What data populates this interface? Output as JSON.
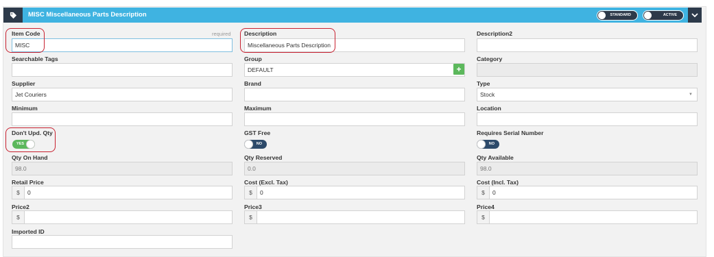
{
  "header": {
    "title": "MISC Miscellaneous Parts Description",
    "toggle_standard": "STANDARD",
    "toggle_active": "ACTIVE",
    "tag_icon": "tag-icon",
    "chevron_icon": "chevron-down-icon",
    "color_bar": "#3fb3e1",
    "color_dark": "#2d3a4a"
  },
  "fields": {
    "item_code": {
      "label": "Item Code",
      "required": "required",
      "value": "MISC"
    },
    "description": {
      "label": "Description",
      "value": "Miscellaneous Parts Description"
    },
    "description2": {
      "label": "Description2",
      "value": ""
    },
    "searchable_tags": {
      "label": "Searchable Tags",
      "value": ""
    },
    "group": {
      "label": "Group",
      "value": "DEFAULT",
      "add_label": "+"
    },
    "category": {
      "label": "Category",
      "value": ""
    },
    "supplier": {
      "label": "Supplier",
      "value": "Jet Couriers"
    },
    "brand": {
      "label": "Brand",
      "value": ""
    },
    "type": {
      "label": "Type",
      "value": "Stock",
      "caret": "▼"
    },
    "minimum": {
      "label": "Minimum",
      "value": ""
    },
    "maximum": {
      "label": "Maximum",
      "value": ""
    },
    "location": {
      "label": "Location",
      "value": ""
    },
    "dont_upd_qty": {
      "label": "Don't Upd. Qty",
      "state": "YES"
    },
    "gst_free": {
      "label": "GST Free",
      "state": "NO"
    },
    "requires_serial": {
      "label": "Requires Serial Number",
      "state": "NO"
    },
    "qty_on_hand": {
      "label": "Qty On Hand",
      "value": "98.0"
    },
    "qty_reserved": {
      "label": "Qty Reserved",
      "value": "0.0"
    },
    "qty_available": {
      "label": "Qty Available",
      "value": "98.0"
    },
    "retail_price": {
      "label": "Retail Price",
      "prefix": "$",
      "value": "0"
    },
    "cost_excl": {
      "label": "Cost (Excl. Tax)",
      "prefix": "$",
      "value": "0"
    },
    "cost_incl": {
      "label": "Cost (Incl. Tax)",
      "prefix": "$",
      "value": "0"
    },
    "price2": {
      "label": "Price2",
      "prefix": "$",
      "value": ""
    },
    "price3": {
      "label": "Price3",
      "prefix": "$",
      "value": ""
    },
    "price4": {
      "label": "Price4",
      "prefix": "$",
      "value": ""
    },
    "imported_id": {
      "label": "Imported ID",
      "value": ""
    }
  },
  "colors": {
    "toggle_on": "#5cb85c",
    "toggle_off": "#2d4a6a",
    "highlight": "#c8202f"
  }
}
